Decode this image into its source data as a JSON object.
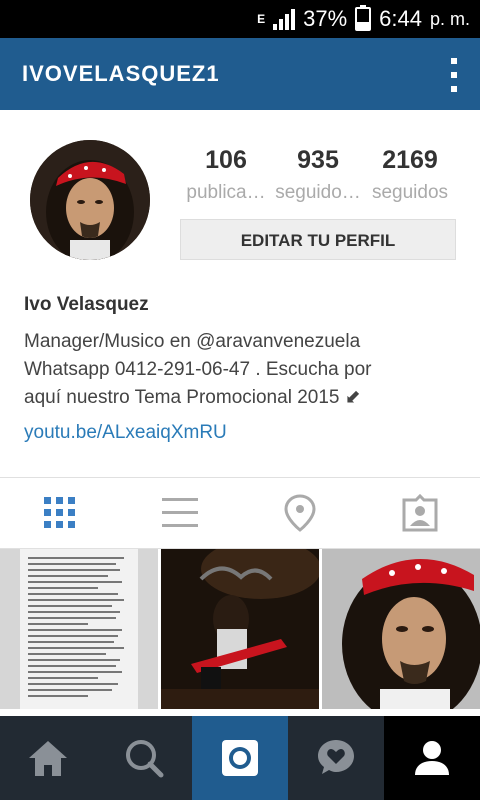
{
  "status_bar": {
    "network": "E",
    "battery_percent": "37%",
    "battery_level": 0.37,
    "time": "6:44",
    "ampm": "p. m."
  },
  "app_bar": {
    "username": "IVOVELASQUEZ1",
    "menu_icon": "overflow-menu-icon"
  },
  "profile": {
    "stats": [
      {
        "value": "106",
        "label": "publica…"
      },
      {
        "value": "935",
        "label": "seguido…"
      },
      {
        "value": "2169",
        "label": "seguidos"
      }
    ],
    "edit_button": "EDITAR TU PERFIL",
    "name": "Ivo Velasquez",
    "bio_lines": [
      "Manager/Musico en @aravanvenezuela",
      "Whatsapp 0412-291-06-47 . Escucha por",
      "aquí nuestro Tema Promocional 2015 ⬋"
    ],
    "link": "youtu.be/ALxeaiqXmRU"
  },
  "tabs": [
    {
      "icon": "grid-icon",
      "active": true
    },
    {
      "icon": "list-icon",
      "active": false
    },
    {
      "icon": "location-pin-icon",
      "active": false
    },
    {
      "icon": "tagged-photos-icon",
      "active": false
    }
  ],
  "colors": {
    "brand": "#205c8f",
    "link": "#2a7bb8",
    "active_tab": "#3b7fc4",
    "inactive_icon": "#aaaaaa",
    "nav_bg": "#222a33"
  },
  "bottom_nav": [
    {
      "icon": "home-icon"
    },
    {
      "icon": "search-icon"
    },
    {
      "icon": "camera-icon"
    },
    {
      "icon": "activity-heart-icon"
    },
    {
      "icon": "profile-icon"
    }
  ]
}
